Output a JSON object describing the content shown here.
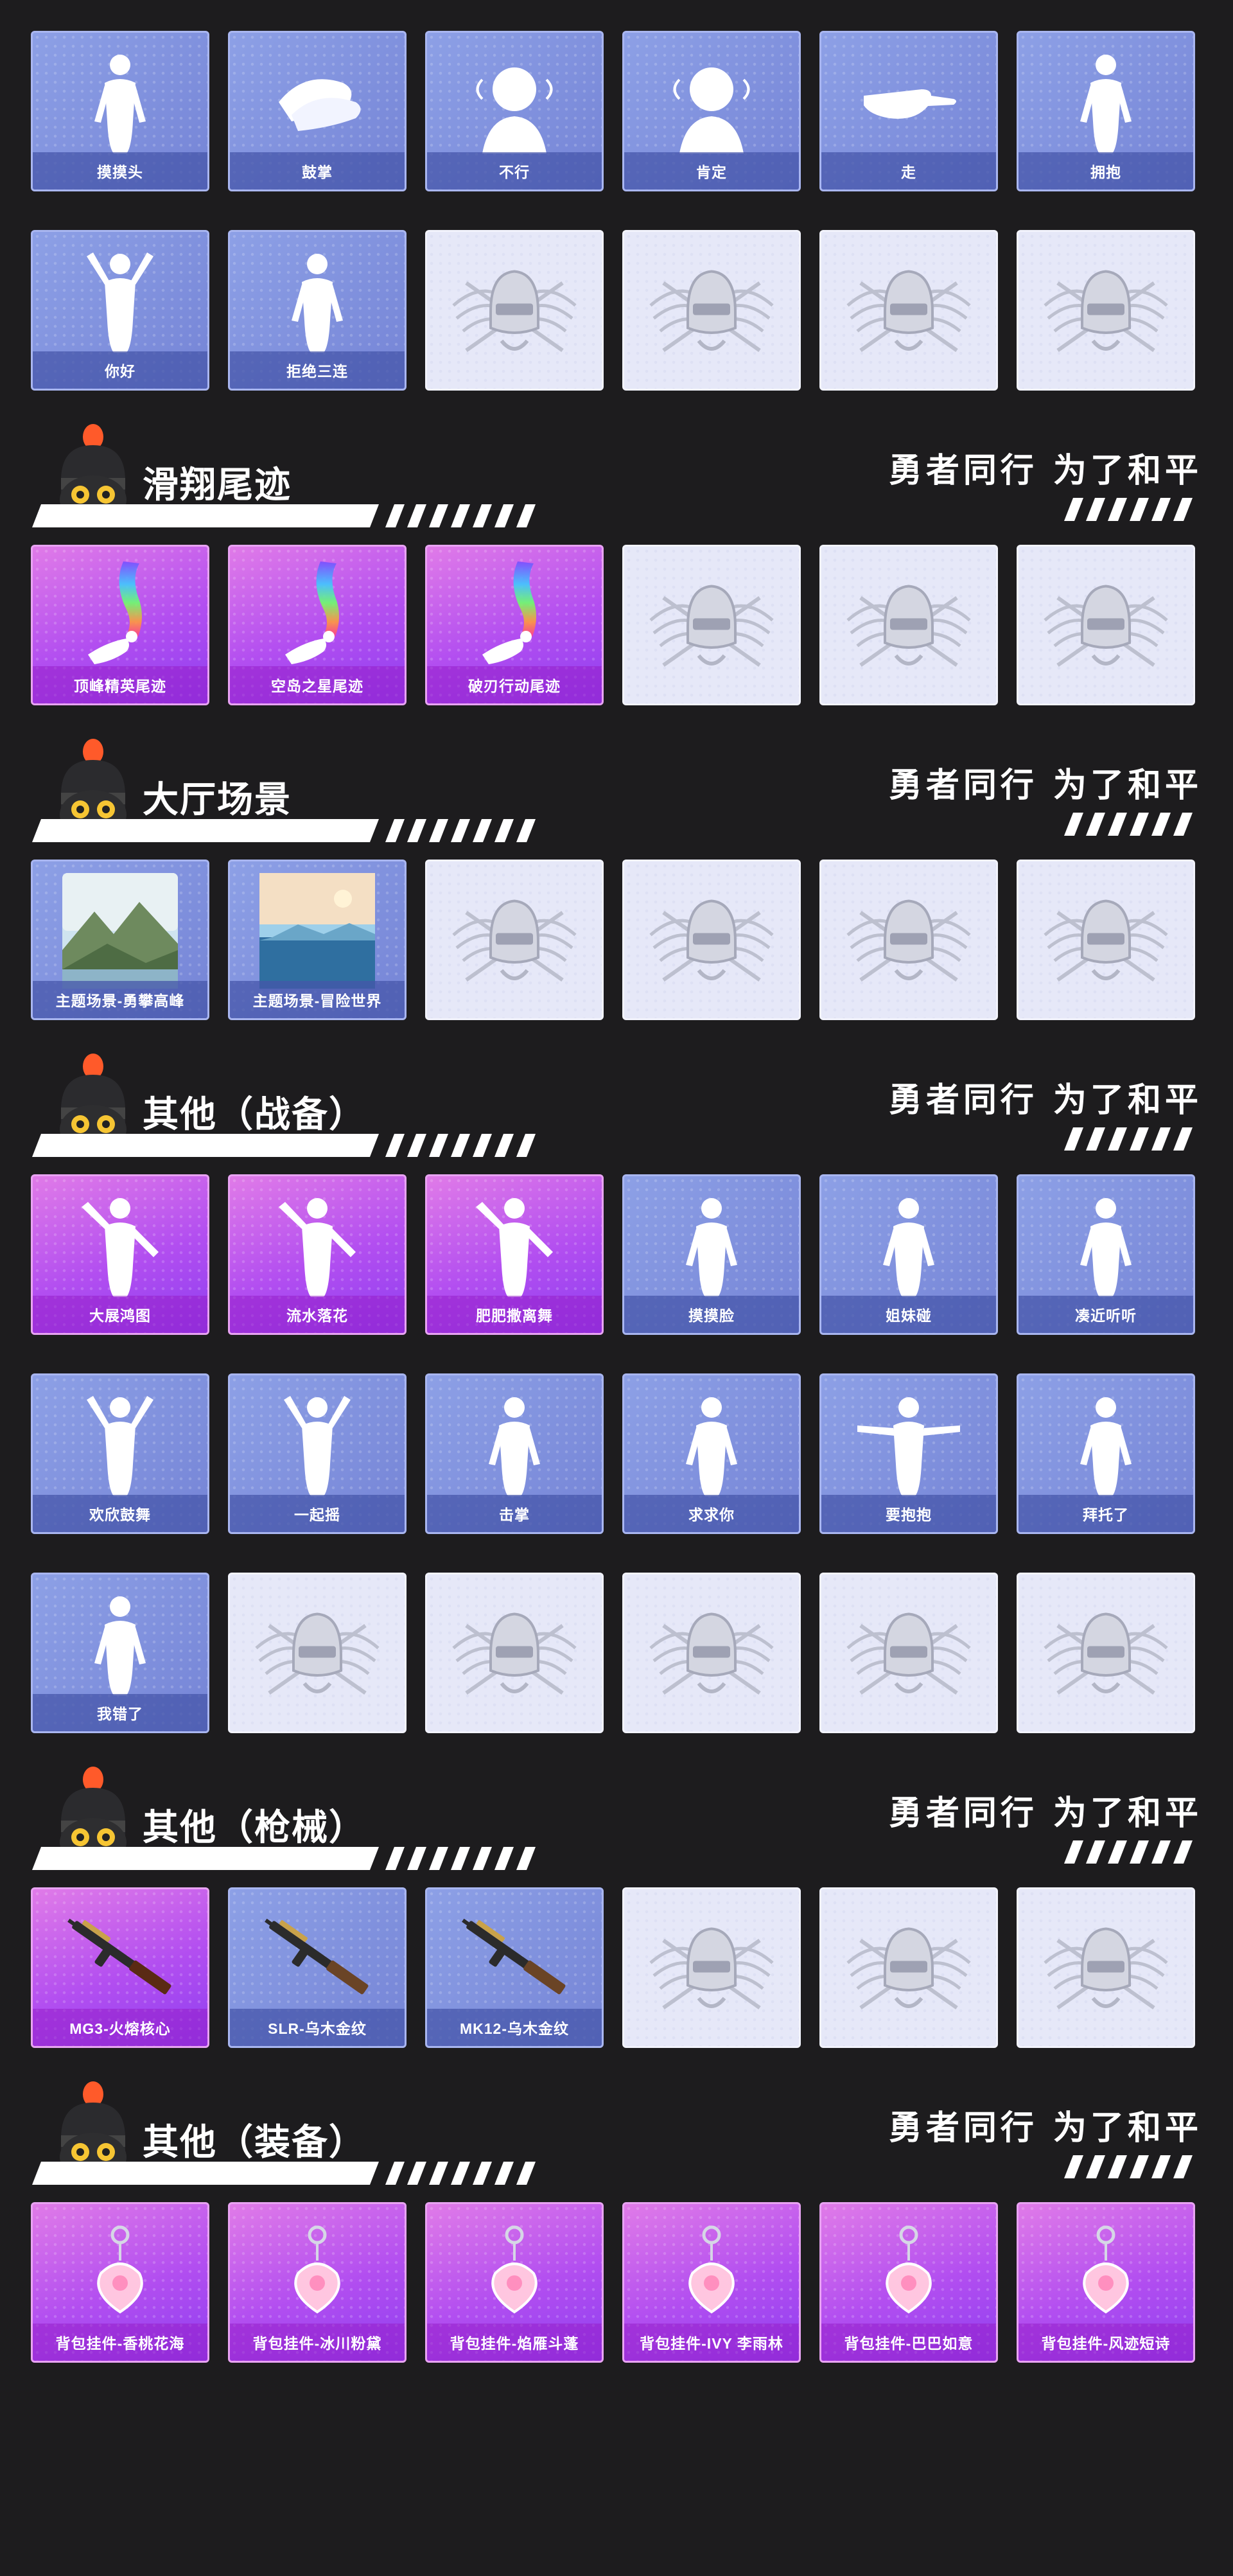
{
  "slogan": "勇者同行 为了和平",
  "colors": {
    "background": "#1d1c1e",
    "card_blue": "#8da0e6",
    "card_purple": "#b24ef0",
    "card_empty": "#e6e8f8"
  },
  "top_grid": {
    "rows": [
      [
        {
          "label": "摸摸头",
          "style": "blue",
          "icon": "emote-figure-icon"
        },
        {
          "label": "鼓掌",
          "style": "blue",
          "icon": "clapping-hands-icon"
        },
        {
          "label": "不行",
          "style": "blue",
          "icon": "head-shake-icon"
        },
        {
          "label": "肯定",
          "style": "blue",
          "icon": "head-nod-icon"
        },
        {
          "label": "走",
          "style": "blue",
          "icon": "pointing-hand-icon"
        },
        {
          "label": "拥抱",
          "style": "blue",
          "icon": "emote-figure-icon"
        }
      ],
      [
        {
          "label": "你好",
          "style": "blue",
          "icon": "waving-figure-icon"
        },
        {
          "label": "拒绝三连",
          "style": "blue",
          "icon": "emote-figure-icon"
        },
        {
          "label": "",
          "style": "empty",
          "icon": "pubg-helmet-emblem-icon"
        },
        {
          "label": "",
          "style": "empty",
          "icon": "pubg-helmet-emblem-icon"
        },
        {
          "label": "",
          "style": "empty",
          "icon": "pubg-helmet-emblem-icon"
        },
        {
          "label": "",
          "style": "empty",
          "icon": "pubg-helmet-emblem-icon"
        }
      ]
    ]
  },
  "sections": [
    {
      "title": "滑翔尾迹",
      "rows": [
        [
          {
            "label": "顶峰精英尾迹",
            "style": "purple",
            "icon": "rainbow-trail-icon"
          },
          {
            "label": "空岛之星尾迹",
            "style": "purple",
            "icon": "rainbow-trail-icon"
          },
          {
            "label": "破刃行动尾迹",
            "style": "purple",
            "icon": "rainbow-trail-icon"
          },
          {
            "label": "",
            "style": "empty",
            "icon": "pubg-helmet-emblem-icon"
          },
          {
            "label": "",
            "style": "empty",
            "icon": "pubg-helmet-emblem-icon"
          },
          {
            "label": "",
            "style": "empty",
            "icon": "pubg-helmet-emblem-icon"
          }
        ]
      ]
    },
    {
      "title": "大厅场景",
      "rows": [
        [
          {
            "label": "主题场景-勇攀高峰",
            "style": "blue",
            "icon": "mountain-scene-icon"
          },
          {
            "label": "主题场景-冒险世界",
            "style": "blue",
            "icon": "ocean-scene-icon"
          },
          {
            "label": "",
            "style": "empty",
            "icon": "pubg-helmet-emblem-icon"
          },
          {
            "label": "",
            "style": "empty",
            "icon": "pubg-helmet-emblem-icon"
          },
          {
            "label": "",
            "style": "empty",
            "icon": "pubg-helmet-emblem-icon"
          },
          {
            "label": "",
            "style": "empty",
            "icon": "pubg-helmet-emblem-icon"
          }
        ]
      ]
    },
    {
      "title": "其他（战备）",
      "rows": [
        [
          {
            "label": "大展鸿图",
            "style": "purple",
            "icon": "dancing-figure-icon"
          },
          {
            "label": "流水落花",
            "style": "purple",
            "icon": "dancing-figure-icon"
          },
          {
            "label": "肥肥撒离舞",
            "style": "purple",
            "icon": "dancing-figure-icon"
          },
          {
            "label": "摸摸脸",
            "style": "blue",
            "icon": "emote-figure-icon"
          },
          {
            "label": "姐妹碰",
            "style": "blue",
            "icon": "emote-figure-icon"
          },
          {
            "label": "凑近听听",
            "style": "blue",
            "icon": "emote-figure-icon"
          }
        ],
        [
          {
            "label": "欢欣鼓舞",
            "style": "blue",
            "icon": "cheering-figure-icon"
          },
          {
            "label": "一起摇",
            "style": "blue",
            "icon": "cheering-figure-icon"
          },
          {
            "label": "击掌",
            "style": "blue",
            "icon": "emote-figure-icon"
          },
          {
            "label": "求求你",
            "style": "blue",
            "icon": "emote-figure-icon"
          },
          {
            "label": "要抱抱",
            "style": "blue",
            "icon": "open-arms-figure-icon"
          },
          {
            "label": "拜托了",
            "style": "blue",
            "icon": "emote-figure-icon"
          }
        ],
        [
          {
            "label": "我错了",
            "style": "blue",
            "icon": "emote-figure-icon"
          },
          {
            "label": "",
            "style": "empty",
            "icon": "pubg-helmet-emblem-icon"
          },
          {
            "label": "",
            "style": "empty",
            "icon": "pubg-helmet-emblem-icon"
          },
          {
            "label": "",
            "style": "empty",
            "icon": "pubg-helmet-emblem-icon"
          },
          {
            "label": "",
            "style": "empty",
            "icon": "pubg-helmet-emblem-icon"
          },
          {
            "label": "",
            "style": "empty",
            "icon": "pubg-helmet-emblem-icon"
          }
        ]
      ]
    },
    {
      "title": "其他（枪械）",
      "rows": [
        [
          {
            "label": "MG3-火熔核心",
            "style": "purple",
            "icon": "machine-gun-icon"
          },
          {
            "label": "SLR-乌木金纹",
            "style": "blue",
            "icon": "rifle-icon"
          },
          {
            "label": "MK12-乌木金纹",
            "style": "blue",
            "icon": "rifle-icon"
          },
          {
            "label": "",
            "style": "empty",
            "icon": "pubg-helmet-emblem-icon"
          },
          {
            "label": "",
            "style": "empty",
            "icon": "pubg-helmet-emblem-icon"
          },
          {
            "label": "",
            "style": "empty",
            "icon": "pubg-helmet-emblem-icon"
          }
        ]
      ]
    },
    {
      "title": "其他（装备）",
      "rows": [
        [
          {
            "label": "背包挂件-香桃花海",
            "style": "purple",
            "icon": "backpack-charm-icon"
          },
          {
            "label": "背包挂件-冰川粉黛",
            "style": "purple",
            "icon": "backpack-charm-icon"
          },
          {
            "label": "背包挂件-焰雁斗蓬",
            "style": "purple",
            "icon": "backpack-charm-icon"
          },
          {
            "label": "背包挂件-IVY 李雨林",
            "style": "purple",
            "icon": "backpack-charm-icon"
          },
          {
            "label": "背包挂件-巴巴如意",
            "style": "purple",
            "icon": "backpack-charm-icon"
          },
          {
            "label": "背包挂件-风迹短诗",
            "style": "purple",
            "icon": "backpack-charm-icon"
          }
        ]
      ]
    }
  ]
}
